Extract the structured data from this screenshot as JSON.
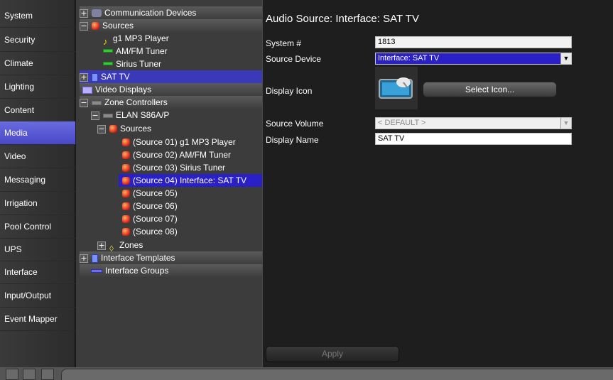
{
  "nav": {
    "items": [
      "System",
      "Security",
      "Climate",
      "Lighting",
      "Content",
      "Media",
      "Video",
      "Messaging",
      "Irrigation",
      "Pool Control",
      "UPS",
      "Interface",
      "Input/Output",
      "Event Mapper"
    ],
    "active": "Media"
  },
  "tree": {
    "communication_devices": "Communication Devices",
    "sources": "Sources",
    "mp3": "g1 MP3 Player",
    "amfm": "AM/FM Tuner",
    "sirius": "Sirius Tuner",
    "sattv": "SAT TV",
    "video_displays": "Video Displays",
    "zone_controllers": "Zone Controllers",
    "elan": "ELAN S86A/P",
    "zone_sources": "Sources",
    "src1": "(Source 01) g1 MP3 Player",
    "src2": "(Source 02) AM/FM Tuner",
    "src3": "(Source 03) Sirius Tuner",
    "src4": "(Source 04) Interface: SAT TV",
    "src5": "(Source 05)",
    "src6": "(Source 06)",
    "src7": "(Source 07)",
    "src8": "(Source 08)",
    "zones": "Zones",
    "interface_templates": "Interface Templates",
    "interface_groups": "Interface Groups"
  },
  "detail": {
    "title": "Audio Source: Interface: SAT TV",
    "system_num_label": "System #",
    "system_num_value": "1813",
    "source_device_label": "Source Device",
    "source_device_value": "Interface: SAT TV",
    "display_icon_label": "Display Icon",
    "select_icon_label": "Select Icon...",
    "source_volume_label": "Source Volume",
    "source_volume_value": "< DEFAULT >",
    "display_name_label": "Display Name",
    "display_name_value": "SAT TV",
    "apply_label": "Apply"
  },
  "colors": {
    "selection": "#2a20c8",
    "nav_active": "#5a5ad8"
  }
}
